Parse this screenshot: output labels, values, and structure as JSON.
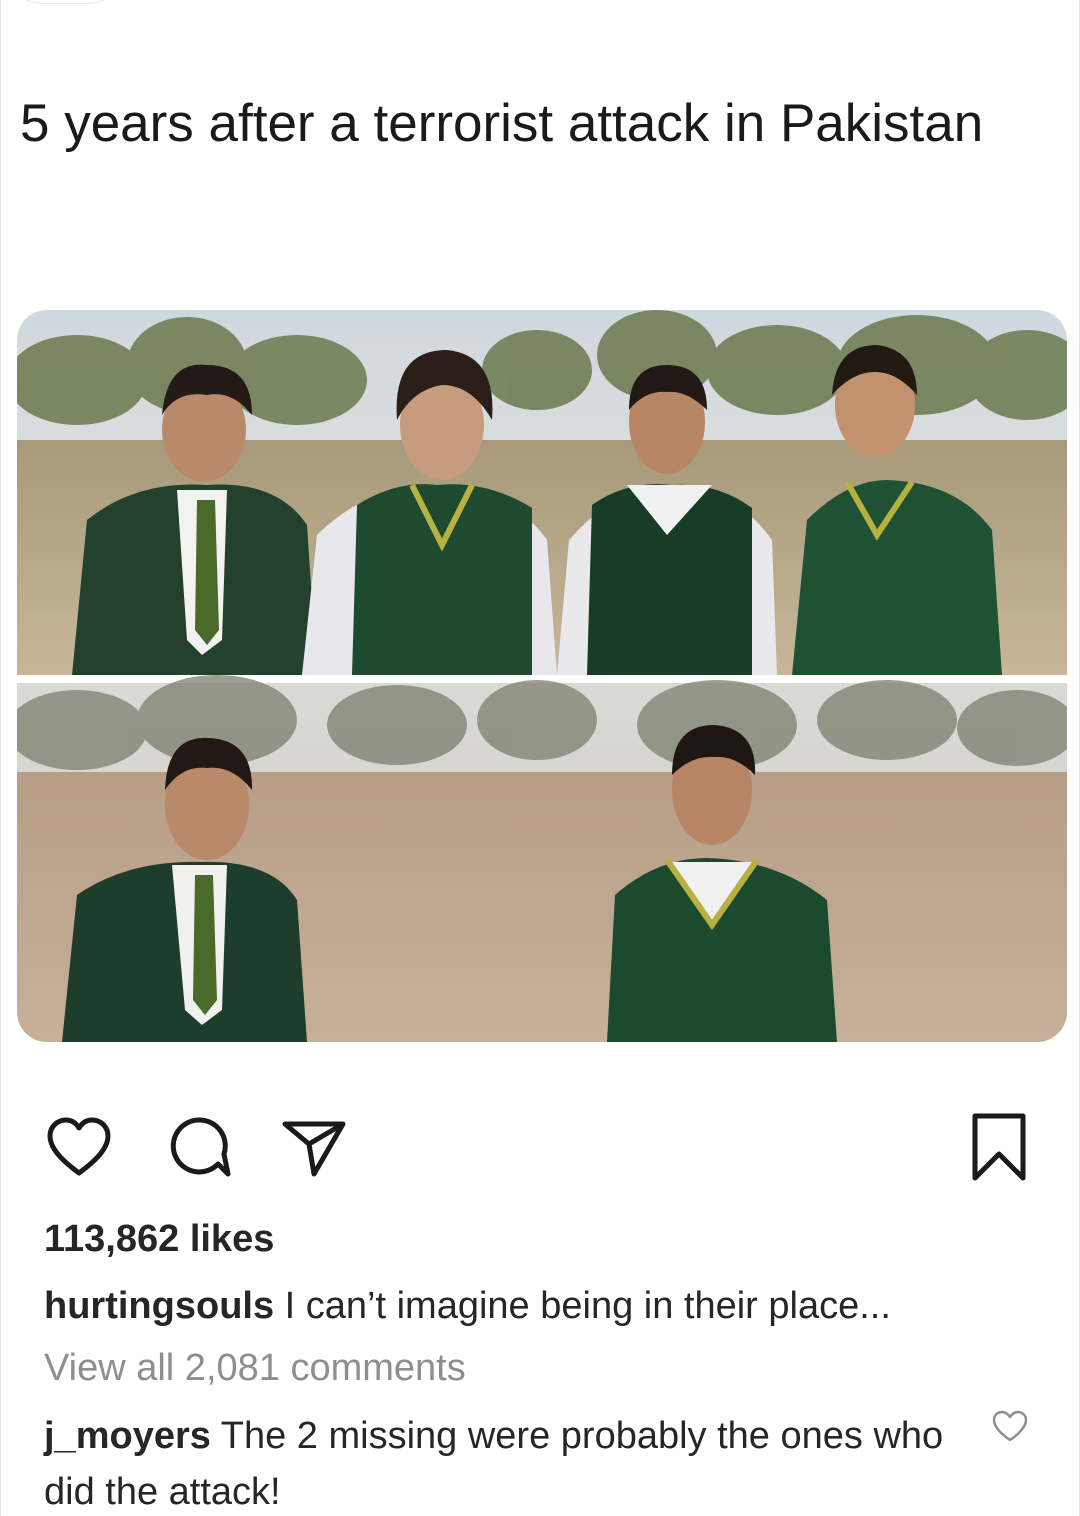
{
  "post": {
    "headline": "5 years after a terrorist attack in Pakistan",
    "photo_icon": "school-photo-comparison"
  },
  "actions": {
    "like_icon": "heart-icon",
    "comment_icon": "comment-icon",
    "share_icon": "send-icon",
    "save_icon": "bookmark-icon"
  },
  "likes": "113,862 likes",
  "caption": {
    "username": "hurtingsouls",
    "text": "I can’t imagine being in their place..."
  },
  "view_all_comments": "View all 2,081 comments",
  "top_comment": {
    "username": "j_moyers",
    "text": "The 2 missing were probably the ones who did the attack!",
    "like_icon": "small-heart-icon"
  }
}
